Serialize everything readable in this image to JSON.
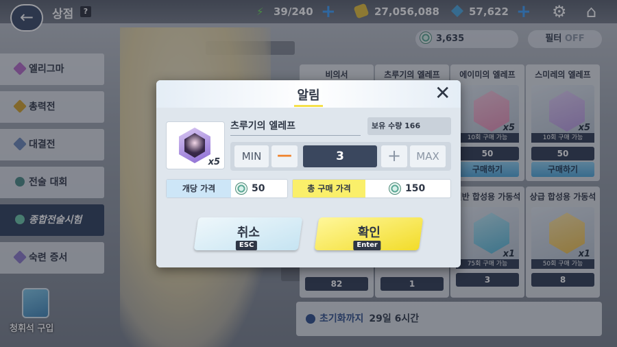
{
  "header": {
    "title": "상점",
    "help_label": "?",
    "ap": "39/240",
    "credits": "27,056,088",
    "pyroxene": "57,622"
  },
  "currency_pill": {
    "value": "3,635"
  },
  "filter": {
    "label": "필터",
    "state": "OFF"
  },
  "sidebar": {
    "items": [
      {
        "label": "엘리그마",
        "color": "#b56bc6"
      },
      {
        "label": "총력전",
        "color": "#d4a22a"
      },
      {
        "label": "대결전",
        "color": "#6b88b8"
      },
      {
        "label": "전술 대회",
        "color": "#4a8a86"
      },
      {
        "label": "종합전술시험",
        "color": "#6bc7a8"
      },
      {
        "label": "숙련 증서",
        "color": "#8a78c8"
      }
    ],
    "pyroxene_purchase": "청휘석 구입"
  },
  "cards": [
    {
      "name": "비의서",
      "qty": "",
      "limit": "",
      "price": "",
      "buy": ""
    },
    {
      "name": "츠루기의 엘레프",
      "qty": "",
      "limit": "",
      "price": "",
      "buy": ""
    },
    {
      "name": "에이미의 엘레프",
      "qty": "x5",
      "limit": "10회 구매 가능",
      "price": "50",
      "buy": "구매하기",
      "color": "#e88fb6"
    },
    {
      "name": "스미레의 엘레프",
      "qty": "x5",
      "limit": "10회 구매 가능",
      "price": "50",
      "buy": "구매하기",
      "color": "#b99be0"
    },
    {
      "name": "",
      "qty": "",
      "limit": "",
      "price": "82",
      "buy": ""
    },
    {
      "name": "",
      "qty": "",
      "limit": "",
      "price": "1",
      "buy": ""
    },
    {
      "name": "일반 합성용 가동석",
      "qty": "x1",
      "limit": "75회 구매 가능",
      "price": "3",
      "buy": "",
      "color": "#55b8d8"
    },
    {
      "name": "상급 합성용 가동석",
      "qty": "x1",
      "limit": "50회 구매 가능",
      "price": "8",
      "buy": "",
      "color": "#f0c04a"
    }
  ],
  "reset": {
    "label": "초기화까지",
    "value": "29일 6시간"
  },
  "modal": {
    "title": "알림",
    "close": "✕",
    "item_name": "츠루기의 엘레프",
    "item_qty": "x5",
    "owned": "보유 수량 166",
    "min_label": "MIN",
    "minus_label": "—",
    "quantity": "3",
    "plus_label": "+",
    "max_label": "MAX",
    "unit_price_label": "개당 가격",
    "unit_price": "50",
    "total_price_label": "총 구매 가격",
    "total_price": "150",
    "cancel_label": "취소",
    "cancel_key": "ESC",
    "confirm_label": "확인",
    "confirm_key": "Enter"
  },
  "colors": {
    "accent_yellow": "#f2dc2a",
    "accent_blue": "#3da0ff",
    "navy": "#2e3645"
  }
}
